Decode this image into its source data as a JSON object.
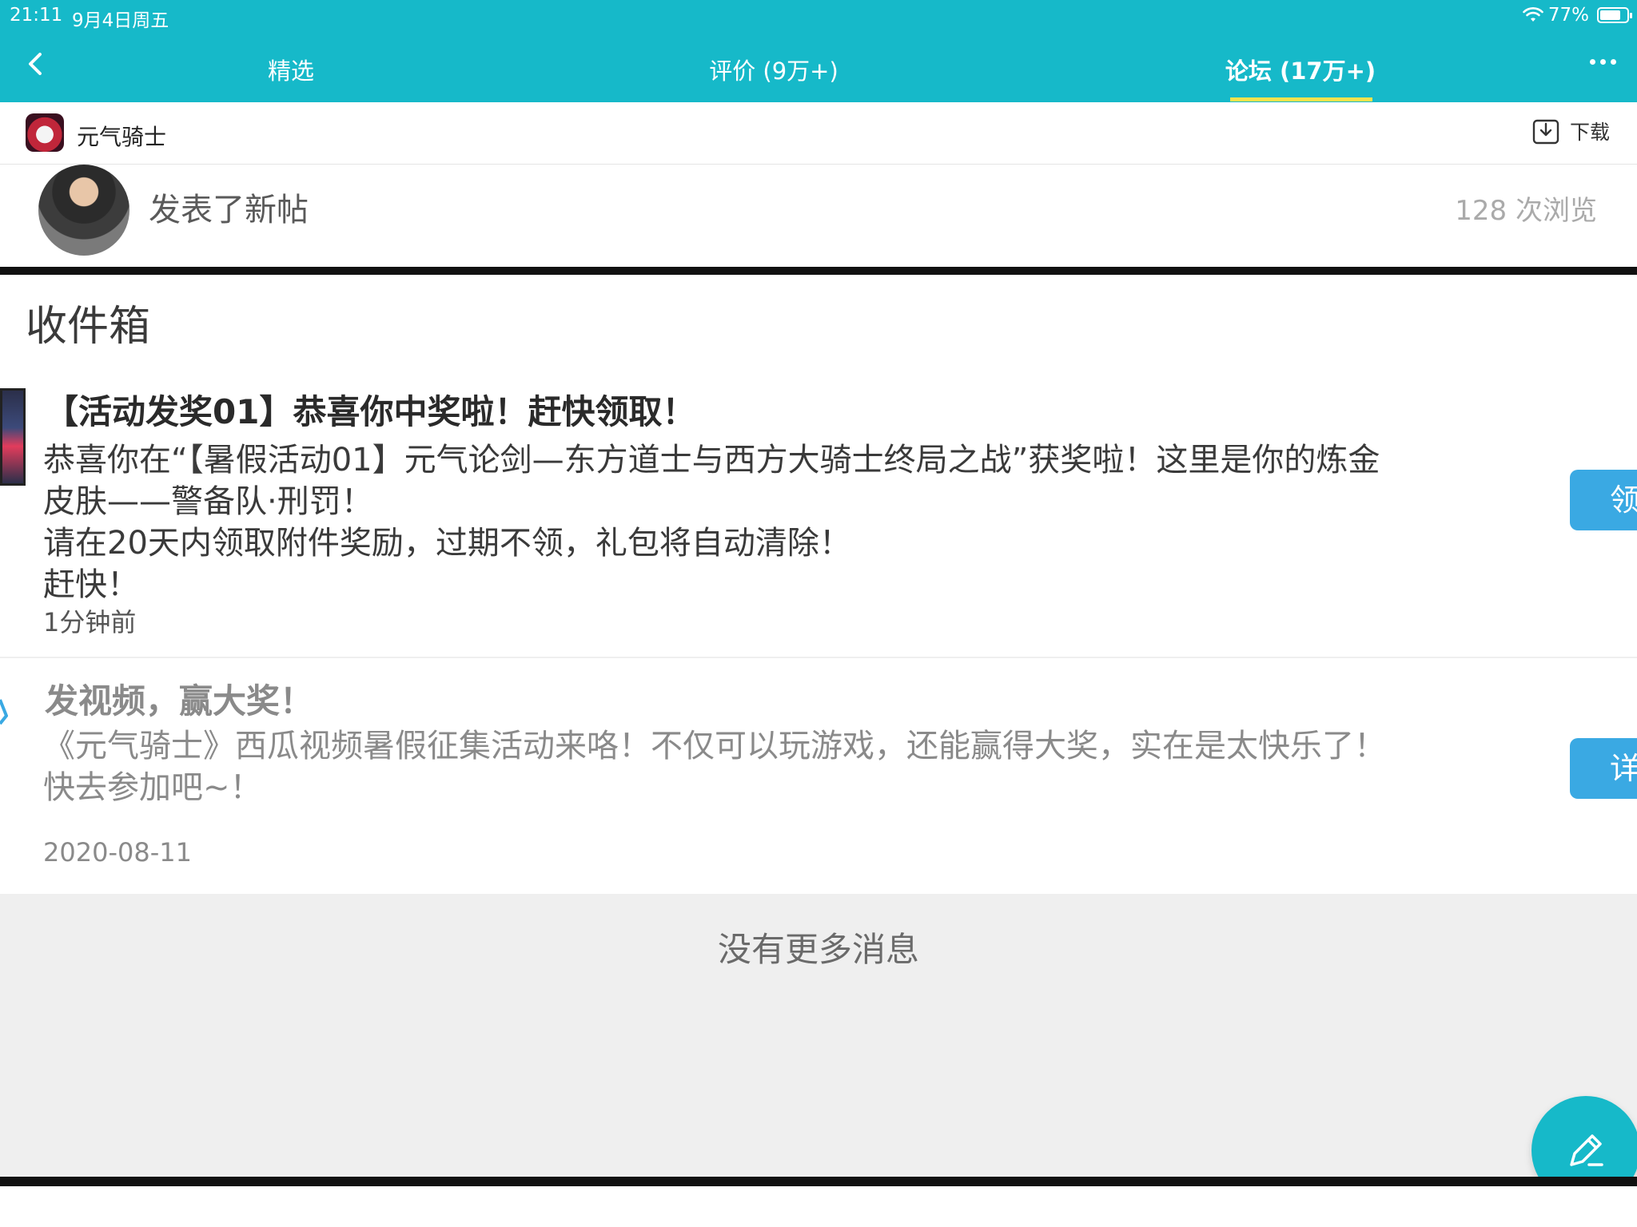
{
  "status_bar": {
    "time": "21:11",
    "date": "9月4日周五",
    "battery": "77%",
    "battery_level": 0.77
  },
  "nav": {
    "tabs": [
      {
        "label": "精选"
      },
      {
        "label": "评价 (9万+)"
      },
      {
        "label": "论坛 (17万+)"
      }
    ],
    "active_tab": 2
  },
  "app_bar": {
    "app_name": "元气骑士",
    "download_label": "下载"
  },
  "post": {
    "action": "发表了新帖",
    "views": "128 次浏览"
  },
  "inbox": {
    "title": "收件箱",
    "messages": [
      {
        "title": "【活动发奖01】恭喜你中奖啦！赶快领取！",
        "lines": [
          "恭喜你在“【暑假活动01】元气论剑—东方道士与西方大骑士终局之战”获奖啦！这里是你的炼金",
          "皮肤——警备队·刑罚！",
          "请在20天内领取附件奖励，过期不领，礼包将自动清除！",
          "赶快！"
        ],
        "time": "1分钟前",
        "button": "领"
      },
      {
        "title": "发视频，赢大奖！",
        "lines": [
          "《元气骑士》西瓜视频暑假征集活动来咯！不仅可以玩游戏，还能赢得大奖，实在是太快乐了！",
          "快去参加吧~！"
        ],
        "time": "2020-08-11",
        "button": "详"
      }
    ],
    "no_more": "没有更多消息"
  },
  "colors": {
    "brand": "#16b9c9",
    "tab_indicator": "#f7e34d",
    "button_blue": "#3aa9e3"
  },
  "icons": {
    "back": "chevron-left-icon",
    "more": "more-dots-icon",
    "download": "download-icon",
    "compose": "pencil-icon",
    "wifi": "wifi-icon",
    "battery": "battery-icon"
  }
}
